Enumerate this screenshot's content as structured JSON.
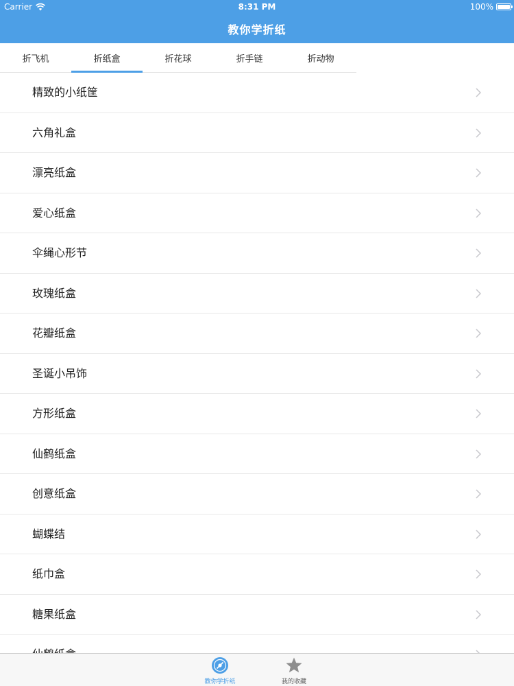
{
  "status_bar": {
    "carrier": "Carrier",
    "time": "8:31 PM",
    "battery": "100%"
  },
  "nav": {
    "title": "教你学折纸"
  },
  "tabs": [
    {
      "label": "折飞机",
      "active": false
    },
    {
      "label": "折纸盒",
      "active": true
    },
    {
      "label": "折花球",
      "active": false
    },
    {
      "label": "折手链",
      "active": false
    },
    {
      "label": "折动物",
      "active": false
    }
  ],
  "list": {
    "items": [
      "精致的小纸筐",
      "六角礼盒",
      "漂亮纸盒",
      "爱心纸盒",
      "伞绳心形节",
      "玫瑰纸盒",
      "花瓣纸盒",
      "圣诞小吊饰",
      "方形纸盒",
      "仙鹤纸盒",
      "创意纸盒",
      "蝴蝶结",
      "纸巾盒",
      "糖果纸盒",
      "仙鹤纸盒"
    ]
  },
  "tabbar": {
    "items": [
      {
        "label": "教你学折纸",
        "icon": "disc-icon",
        "active": true
      },
      {
        "label": "我的收藏",
        "icon": "star-icon",
        "active": false
      }
    ]
  },
  "colors": {
    "accent": "#4d9fe6",
    "inactive_icon": "#8e8e8e",
    "chevron": "#c7c7cc"
  }
}
